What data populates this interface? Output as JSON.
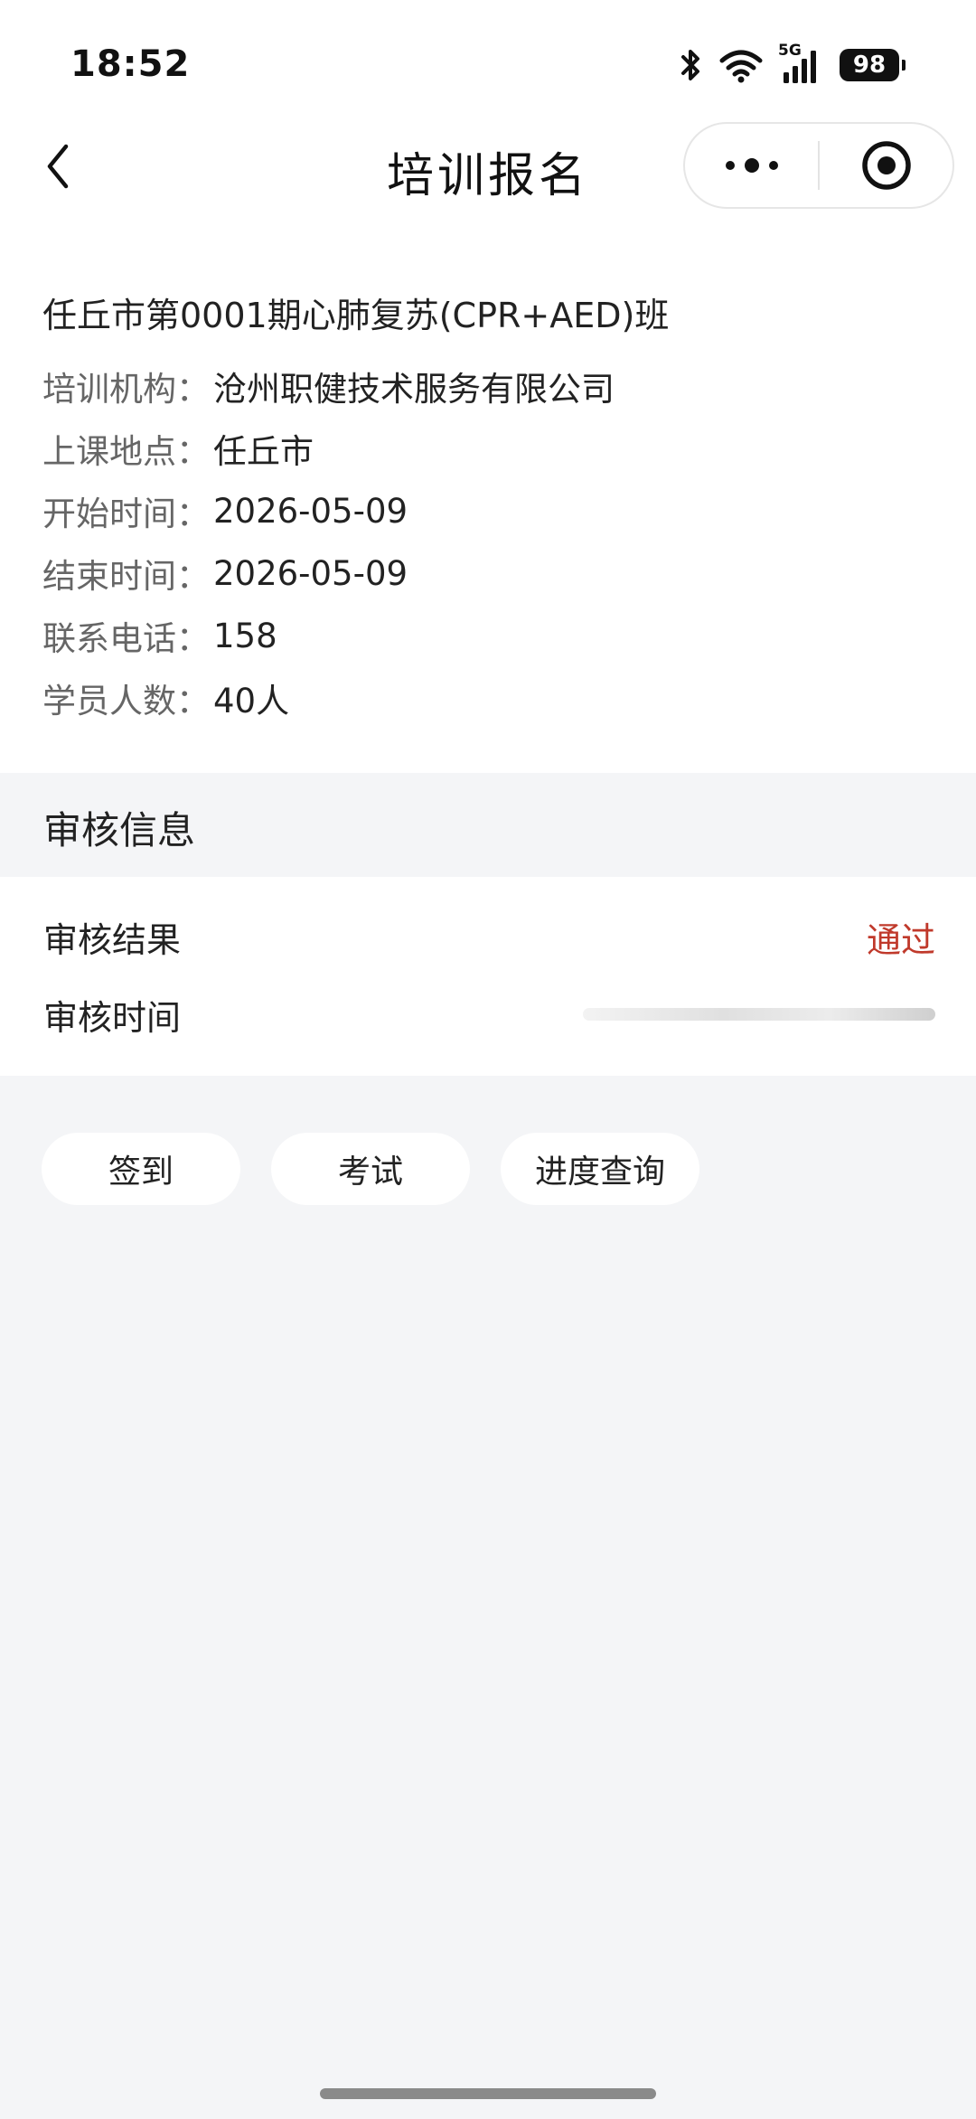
{
  "status_bar": {
    "time": "18:52",
    "network": "5G",
    "battery": "98",
    "icons": [
      "bluetooth-icon",
      "wifi-icon",
      "cellular-signal-icon",
      "battery-icon"
    ]
  },
  "nav": {
    "title": "培训报名",
    "back_icon": "chevron-left-icon",
    "more_icon": "more-dots-icon",
    "close_icon": "target-circle-icon"
  },
  "course": {
    "title": "任丘市第0001期心肺复苏(CPR+AED)班",
    "fields": [
      {
        "label": "培训机构：",
        "value": "沧州职健技术服务有限公司"
      },
      {
        "label": "上课地点：",
        "value": "任丘市"
      },
      {
        "label": "开始时间：",
        "value": "2026-05-09"
      },
      {
        "label": "结束时间：",
        "value": "2026-05-09"
      },
      {
        "label": "联系电话：",
        "value": "158"
      },
      {
        "label": "学员人数：",
        "value": "40人"
      }
    ]
  },
  "review": {
    "section_title": "审核信息",
    "result_label": "审核结果",
    "result_value": "通过",
    "time_label": "审核时间"
  },
  "actions": {
    "checkin": "签到",
    "exam": "考试",
    "progress": "进度查询"
  },
  "colors": {
    "page_bg": "#f4f5f7",
    "card_bg": "#ffffff",
    "pass_red": "#c0392b",
    "label_gray": "#666666"
  }
}
